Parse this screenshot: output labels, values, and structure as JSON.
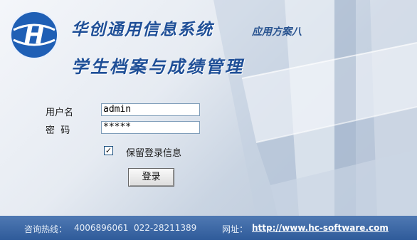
{
  "app": {
    "title": "华创通用信息系统",
    "subtitle": "应用方案八",
    "module_title": "学生档案与成绩管理"
  },
  "login": {
    "username_label": "用户名",
    "username_value": "admin",
    "password_label": "密  码",
    "password_value": "*****",
    "remember_label": "保留登录信息",
    "remember_checked": true,
    "submit_label": "登录"
  },
  "footer": {
    "hotline_label": "咨询热线：",
    "hotline_numbers": "4006896061  022-28211389",
    "website_label": "网址：",
    "website_url": "http://www.hc-software.com"
  },
  "colors": {
    "accent": "#1f4f97",
    "footer_bg": "#3b66a6"
  }
}
